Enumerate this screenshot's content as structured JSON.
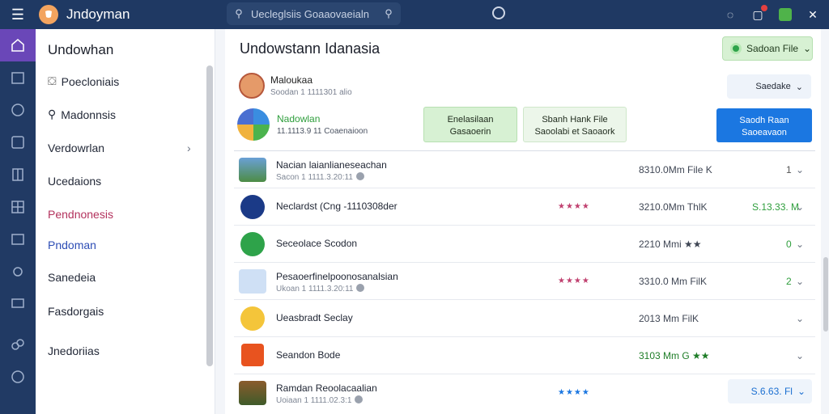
{
  "app": {
    "name": "Jndoyman",
    "search_text": "Uecleglsiis Goaaovaeialn",
    "icons": [
      "menu-icon",
      "app-logo",
      "search-icon",
      "refresh-icon",
      "help-icon",
      "notifications-icon",
      "status-icon",
      "close-icon"
    ]
  },
  "sidebar": {
    "title": "Undowhan",
    "items": [
      {
        "label": "Poecloniais",
        "icon": "people-icon"
      },
      {
        "label": "Madonnsis",
        "icon": "search-icon"
      },
      {
        "label": "Verdowrlan",
        "icon": "chevron-right-icon"
      },
      {
        "label": "Ucedaions"
      },
      {
        "label": "Pendnonesis",
        "color": "#b3325d"
      },
      {
        "label": "Pndoman",
        "color": "#2d4db5"
      },
      {
        "label": "Sanedeia"
      },
      {
        "label": "Fasdorgais"
      },
      {
        "label": "Jnedoriias"
      }
    ]
  },
  "main": {
    "title": "Undowstann Idanasia",
    "top_button": "Sadoan File",
    "profile": {
      "name": "Maloukaa",
      "sub": "Soodan 1 1111301 alio"
    },
    "select_label": "Saedake",
    "hero": {
      "name": "Nadowlan",
      "sub": "11.1113.9 11 Coaenaioon",
      "btn1_line1": "Enelasilaan",
      "btn1_line2": "Gasaoerin",
      "btn2_line1": "Sbanh Hank File",
      "btn2_line2": "Saoolabi et Saoaork",
      "btn3_line1": "Saodh Raan",
      "btn3_line2": "Saoeavaon"
    },
    "rows": [
      {
        "title": "Nacian laianlianeseachan",
        "sub": "Sacon 1 1111.3.20:11",
        "stars": "",
        "size": "8310.0Mm File K",
        "price": "1"
      },
      {
        "title": "Neclardst (Cng -1110308der",
        "sub": "",
        "stars": "★★★★",
        "size": "3210.0Mm ThlK",
        "price": "S.13.33. M"
      },
      {
        "title": "Seceolace Scodon",
        "sub": "",
        "stars": "",
        "size": "2210 Mmi ★★",
        "price": "0"
      },
      {
        "title": "Pesaoerfinelpoonosanalsian",
        "sub": "Ukoan 1 1111.3.20:11",
        "stars": "★★★★",
        "size": "3310.0 Mm FilK",
        "price": "2"
      },
      {
        "title": "Ueasbradt Seclay",
        "sub": "",
        "stars": "",
        "size": "2013 Mm FilK",
        "price": ""
      },
      {
        "title": "Seandon Bode",
        "sub": "",
        "stars": "",
        "size": "3103 Mm G ★★",
        "price": ""
      },
      {
        "title": "Ramdan Reoolacaalian",
        "sub": "Uoiaan 1 1111.02.3:1",
        "stars": "★★★★",
        "size": "",
        "price": "S.6.63. Fl"
      }
    ]
  },
  "colors": {
    "titlebar": "#1f3963",
    "rail": "#213a64",
    "rail_active": "#6a47b8",
    "accent_blue": "#1b77e1",
    "accent_green": "#2e9e3c"
  }
}
